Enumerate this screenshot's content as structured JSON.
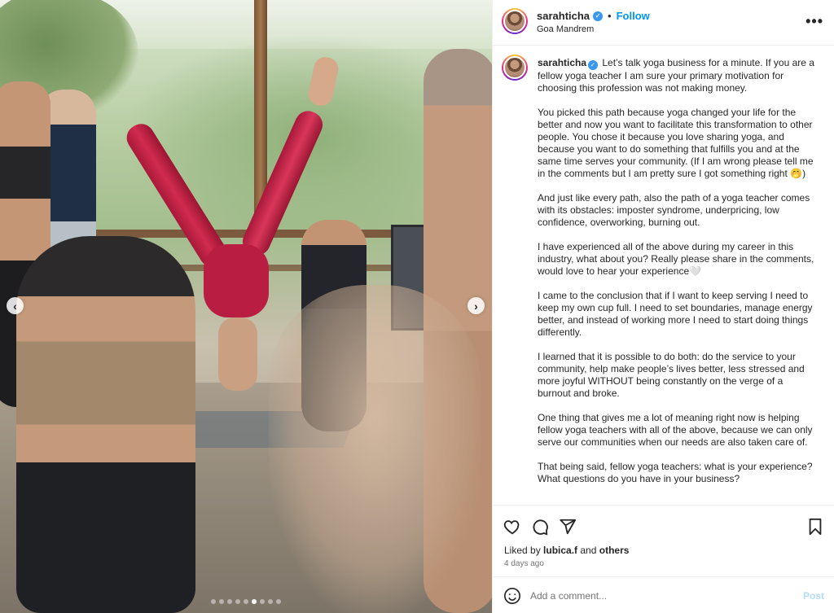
{
  "post": {
    "username": "sarahticha",
    "follow_label": "Follow",
    "dot": "•",
    "location": "Goa Mandrem",
    "more_label": "•••"
  },
  "media": {
    "prev_arrow": "‹",
    "next_arrow": "›",
    "slide_count": 9,
    "active_slide": 6
  },
  "caption": {
    "username": "sarahticha",
    "paragraphs": [
      "Let’s talk yoga business for a minute. If you are a fellow yoga teacher I am sure your primary motivation for choosing this profession was not making money.",
      "You picked this path because yoga changed your life for the better and now you want to facilitate this transformation to other people. You chose it because you love sharing yoga, and because you want to do something that fulfills you and at the same time serves your community. (If I am wrong please tell me in the comments but I am pretty sure I got something right 🤭)",
      "And just like every path, also the path of a yoga teacher comes with its obstacles: imposter syndrome, underpricing, low confidence, overworking, burning out.",
      "I have experienced all of the above during my career in this industry, what about you? Really please share in the comments, would love to hear your experience🤍",
      "I came to the conclusion that if I want to keep serving I need to keep my own cup full. I need to set boundaries, manage energy better, and instead of working more I need to start doing things differently.",
      "I learned that it is possible to do both: do the service to your community, help make people’s lives better, less stressed and more joyful WITHOUT being constantly on the verge of a burnout and broke.",
      "One thing that gives me a lot of meaning right now is helping fellow yoga teachers with all of the above, because we can only serve our communities when our needs are also taken care of.",
      "That being said, fellow yoga teachers: what is your experience? What questions do you have in your business?"
    ]
  },
  "actions": {
    "liked_prefix": "Liked by ",
    "liked_user": "lubica.f",
    "liked_and": " and ",
    "liked_others": "others",
    "time_ago": "4 days ago"
  },
  "comment": {
    "placeholder": "Add a comment...",
    "post_label": "Post"
  }
}
